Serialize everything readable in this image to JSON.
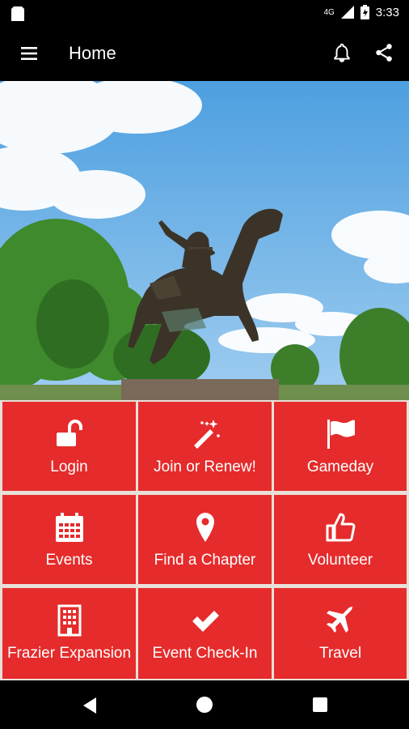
{
  "status": {
    "network": "4G",
    "time": "3:33"
  },
  "appbar": {
    "title": "Home",
    "menu_icon": "menu-icon",
    "notify_icon": "bell-icon",
    "share_icon": "share-icon"
  },
  "tiles": [
    {
      "label": "Login",
      "icon": "unlock-icon"
    },
    {
      "label": "Join or Renew!",
      "icon": "magic-wand-icon"
    },
    {
      "label": "Gameday",
      "icon": "flag-icon"
    },
    {
      "label": "Events",
      "icon": "calendar-icon"
    },
    {
      "label": "Find a Chapter",
      "icon": "map-pin-icon"
    },
    {
      "label": "Volunteer",
      "icon": "thumbs-up-icon"
    },
    {
      "label": "Frazier Expansion",
      "icon": "building-icon"
    },
    {
      "label": "Event Check-In",
      "icon": "check-icon"
    },
    {
      "label": "Travel",
      "icon": "airplane-icon"
    }
  ],
  "colors": {
    "tile": "#e52b2b",
    "bar": "#000000",
    "sky": "#5ba9e6"
  }
}
